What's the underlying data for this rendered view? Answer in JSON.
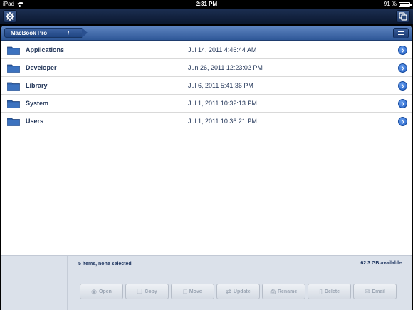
{
  "statusbar": {
    "device": "iPad",
    "time": "2:31 PM",
    "battery": "91 %"
  },
  "navbar": {
    "left_icon": "gear-icon",
    "right_icon": "copies-icon"
  },
  "pathbar": {
    "crumbs": [
      "MacBook Pro",
      "/"
    ],
    "menu_icon": "list-menu-icon"
  },
  "files": [
    {
      "name": "Applications",
      "date": "Jul 14, 2011 4:46:44 AM"
    },
    {
      "name": "Developer",
      "date": "Jun 26, 2011 12:23:02 PM"
    },
    {
      "name": "Library",
      "date": "Jul 6, 2011 5:41:36 PM"
    },
    {
      "name": "System",
      "date": "Jul 1, 2011 10:32:13 PM"
    },
    {
      "name": "Users",
      "date": "Jul 1, 2011 10:36:21 PM"
    }
  ],
  "footer": {
    "selection_status": "5 items, none selected",
    "available": "62.3 GB available"
  },
  "actions": [
    {
      "label": "Open",
      "icon": "eye-icon"
    },
    {
      "label": "Copy",
      "icon": "copy-icon"
    },
    {
      "label": "Move",
      "icon": "document-icon"
    },
    {
      "label": "Update",
      "icon": "sync-icon"
    },
    {
      "label": "Rename",
      "icon": "rename-icon"
    },
    {
      "label": "Delete",
      "icon": "trash-icon"
    },
    {
      "label": "Email",
      "icon": "envelope-icon"
    }
  ],
  "colors": {
    "navbar": "#13264a",
    "pathbar": "#4670b0",
    "text": "#24375a",
    "accent": "#1f5dc4"
  }
}
